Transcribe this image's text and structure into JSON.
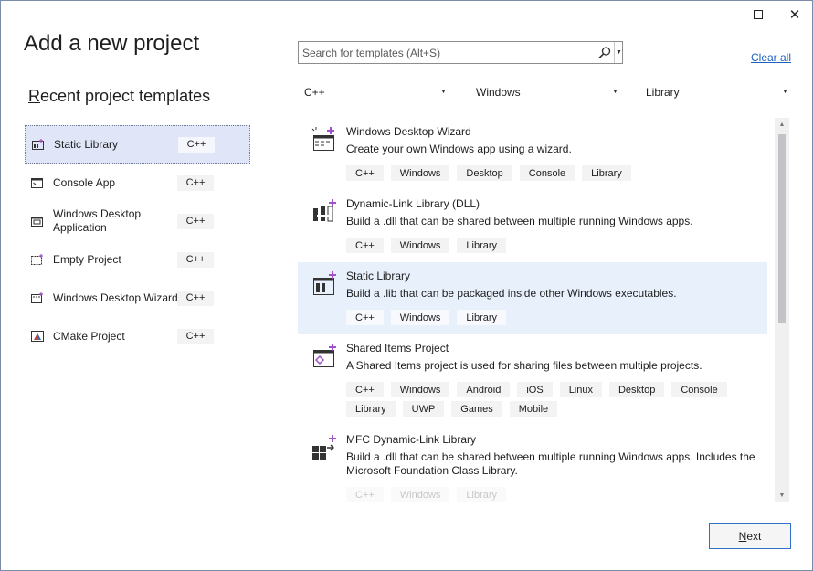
{
  "window": {
    "title": "Add a new project"
  },
  "recent": {
    "heading_first": "R",
    "heading_rest": "ecent project templates",
    "items": [
      {
        "label": "Static Library",
        "lang": "C++",
        "icon": "static-library-icon"
      },
      {
        "label": "Console App",
        "lang": "C++",
        "icon": "console-app-icon"
      },
      {
        "label": "Windows Desktop Application",
        "lang": "C++",
        "icon": "windows-desktop-app-icon"
      },
      {
        "label": "Empty Project",
        "lang": "C++",
        "icon": "empty-project-icon"
      },
      {
        "label": "Windows Desktop Wizard",
        "lang": "C++",
        "icon": "windows-desktop-wizard-icon"
      },
      {
        "label": "CMake Project",
        "lang": "C++",
        "icon": "cmake-project-icon"
      }
    ]
  },
  "search": {
    "placeholder": "Search for templates (Alt+S)"
  },
  "clear_all": "Clear all",
  "filters": {
    "language": "C++",
    "platform": "Windows",
    "project_type": "Library"
  },
  "templates": [
    {
      "name": "Windows Desktop Wizard",
      "description": "Create your own Windows app using a wizard.",
      "tags": [
        "C++",
        "Windows",
        "Desktop",
        "Console",
        "Library"
      ]
    },
    {
      "name": "Dynamic-Link Library (DLL)",
      "description": "Build a .dll that can be shared between multiple running Windows apps.",
      "tags": [
        "C++",
        "Windows",
        "Library"
      ]
    },
    {
      "name": "Static Library",
      "description": "Build a .lib that can be packaged inside other Windows executables.",
      "tags": [
        "C++",
        "Windows",
        "Library"
      ]
    },
    {
      "name": "Shared Items Project",
      "description": "A Shared Items project is used for sharing files between multiple projects.",
      "tags": [
        "C++",
        "Windows",
        "Android",
        "iOS",
        "Linux",
        "Desktop",
        "Console",
        "Library",
        "UWP",
        "Games",
        "Mobile"
      ]
    },
    {
      "name": "MFC Dynamic-Link Library",
      "description": "Build a .dll that can be shared between multiple running Windows apps. Includes the Microsoft Foundation Class Library.",
      "tags": [
        "C++",
        "Windows",
        "Library"
      ]
    }
  ],
  "next_button": {
    "first": "N",
    "rest": "ext"
  },
  "colors": {
    "accent": "#2e71c4",
    "selection": "#e8f0fc",
    "link": "#1a62c0",
    "icon_purple": "#a050c8"
  }
}
